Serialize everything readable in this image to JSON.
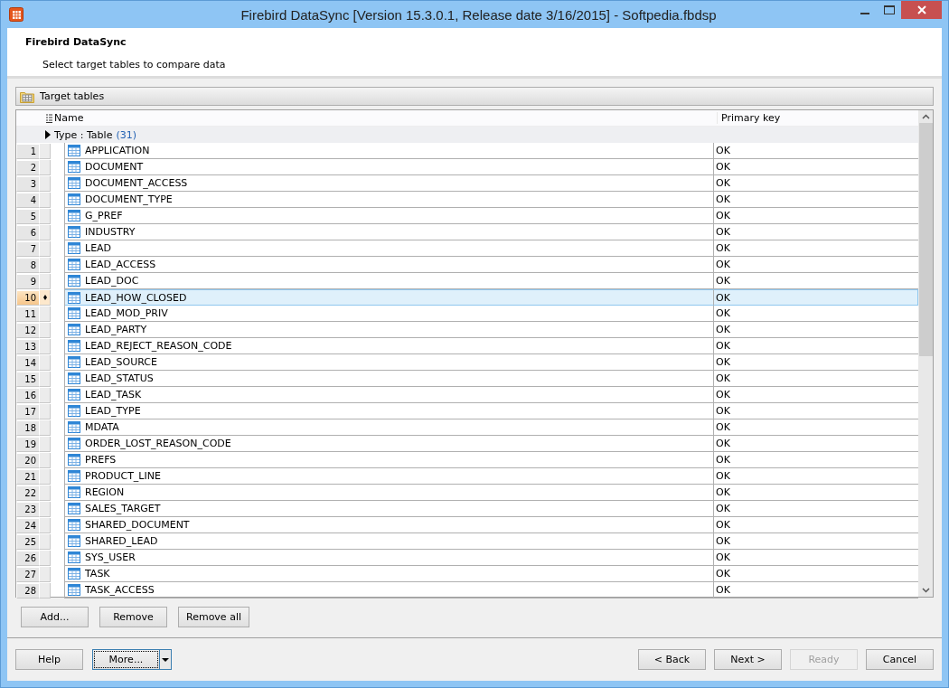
{
  "window": {
    "title": "Firebird DataSync [Version 15.3.0.1, Release date 3/16/2015] - Softpedia.fbdsp"
  },
  "header": {
    "title": "Firebird DataSync",
    "subtitle": "Select target tables to compare data"
  },
  "panel": {
    "title": "Target tables"
  },
  "table": {
    "columns": [
      "Name",
      "Primary key"
    ],
    "group": {
      "label": "Type : Table",
      "count": "(31)",
      "expanded": false
    },
    "rows": [
      {
        "number": "1",
        "name": "APPLICATION",
        "primary_key": "OK",
        "selected": false
      },
      {
        "number": "2",
        "name": "DOCUMENT",
        "primary_key": "OK",
        "selected": false
      },
      {
        "number": "3",
        "name": "DOCUMENT_ACCESS",
        "primary_key": "OK",
        "selected": false
      },
      {
        "number": "4",
        "name": "DOCUMENT_TYPE",
        "primary_key": "OK",
        "selected": false
      },
      {
        "number": "5",
        "name": "G_PREF",
        "primary_key": "OK",
        "selected": false
      },
      {
        "number": "6",
        "name": "INDUSTRY",
        "primary_key": "OK",
        "selected": false
      },
      {
        "number": "7",
        "name": "LEAD",
        "primary_key": "OK",
        "selected": false
      },
      {
        "number": "8",
        "name": "LEAD_ACCESS",
        "primary_key": "OK",
        "selected": false
      },
      {
        "number": "9",
        "name": "LEAD_DOC",
        "primary_key": "OK",
        "selected": false
      },
      {
        "number": "10",
        "name": "LEAD_HOW_CLOSED",
        "primary_key": "OK",
        "selected": true
      },
      {
        "number": "11",
        "name": "LEAD_MOD_PRIV",
        "primary_key": "OK",
        "selected": false
      },
      {
        "number": "12",
        "name": "LEAD_PARTY",
        "primary_key": "OK",
        "selected": false
      },
      {
        "number": "13",
        "name": "LEAD_REJECT_REASON_CODE",
        "primary_key": "OK",
        "selected": false
      },
      {
        "number": "14",
        "name": "LEAD_SOURCE",
        "primary_key": "OK",
        "selected": false
      },
      {
        "number": "15",
        "name": "LEAD_STATUS",
        "primary_key": "OK",
        "selected": false
      },
      {
        "number": "16",
        "name": "LEAD_TASK",
        "primary_key": "OK",
        "selected": false
      },
      {
        "number": "17",
        "name": "LEAD_TYPE",
        "primary_key": "OK",
        "selected": false
      },
      {
        "number": "18",
        "name": "MDATA",
        "primary_key": "OK",
        "selected": false
      },
      {
        "number": "19",
        "name": "ORDER_LOST_REASON_CODE",
        "primary_key": "OK",
        "selected": false
      },
      {
        "number": "20",
        "name": "PREFS",
        "primary_key": "OK",
        "selected": false
      },
      {
        "number": "21",
        "name": "PRODUCT_LINE",
        "primary_key": "OK",
        "selected": false
      },
      {
        "number": "22",
        "name": "REGION",
        "primary_key": "OK",
        "selected": false
      },
      {
        "number": "23",
        "name": "SALES_TARGET",
        "primary_key": "OK",
        "selected": false
      },
      {
        "number": "24",
        "name": "SHARED_DOCUMENT",
        "primary_key": "OK",
        "selected": false
      },
      {
        "number": "25",
        "name": "SHARED_LEAD",
        "primary_key": "OK",
        "selected": false
      },
      {
        "number": "26",
        "name": "SYS_USER",
        "primary_key": "OK",
        "selected": false
      },
      {
        "number": "27",
        "name": "TASK",
        "primary_key": "OK",
        "selected": false
      },
      {
        "number": "28",
        "name": "TASK_ACCESS",
        "primary_key": "OK",
        "selected": false
      }
    ]
  },
  "list_buttons": [
    "Add...",
    "Remove",
    "Remove all"
  ],
  "footer": {
    "left": [
      {
        "label": "Help",
        "kind": "plain",
        "disabled": false
      },
      {
        "label": "More...",
        "kind": "split",
        "disabled": false
      }
    ],
    "right": [
      {
        "label": "< Back",
        "kind": "plain",
        "disabled": false
      },
      {
        "label": "Next >",
        "kind": "plain",
        "disabled": false
      },
      {
        "label": "Ready",
        "kind": "plain",
        "disabled": true
      },
      {
        "label": "Cancel",
        "kind": "plain",
        "disabled": false
      }
    ]
  }
}
